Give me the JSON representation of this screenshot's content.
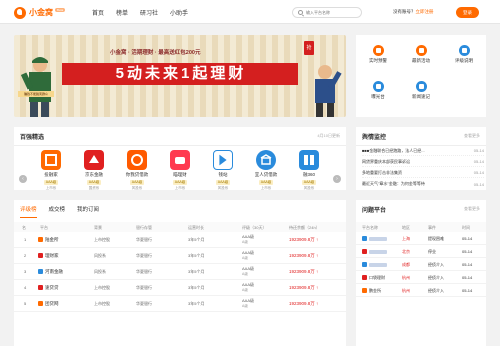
{
  "header": {
    "logo_text": "小金窝",
    "logo_beta": "Beta",
    "nav": [
      "首页",
      "榜单",
      "研习社",
      "小助手"
    ],
    "search_placeholder": "输入平台名称",
    "account_prompt": "没有账号？",
    "login": "立即注册",
    "cta": "登录"
  },
  "banner": {
    "tagline": "小金窝 · 活期理财 · 最高送红包200元",
    "headline": "5动未来1起理财",
    "left_slogan": "赚钱不能脱离群众",
    "right_badge": "抢"
  },
  "quick_links": [
    {
      "label": "实时预警",
      "color": "#ff6a00"
    },
    {
      "label": "最新活动",
      "color": "#ff6a00"
    },
    {
      "label": "评级说明",
      "color": "#2a8bdc"
    },
    {
      "label": "曝光台",
      "color": "#2a8bdc"
    },
    {
      "label": "新闻速记",
      "color": "#2a8bdc"
    }
  ],
  "top_picks": {
    "title": "百强精选",
    "date": "4月10日更新",
    "platforms": [
      {
        "name": "投融家",
        "rating": "AAA级",
        "type": "上市系",
        "color": "#ff6a00"
      },
      {
        "name": "京东金融",
        "rating": "AAA级",
        "type": "国资系",
        "color": "#e02020"
      },
      {
        "name": "你我贷借款",
        "rating": "AAA级",
        "type": "风投系",
        "color": "#ff5a00"
      },
      {
        "name": "瞄理财",
        "rating": "AAA级",
        "type": "上市系",
        "color": "#ff3a50"
      },
      {
        "name": "钱站",
        "rating": "AAA级",
        "type": "风投系",
        "color": "#2a8bdc"
      },
      {
        "name": "宜人贷借款",
        "rating": "AAA级",
        "type": "上市系",
        "color": "#2a8bdc"
      },
      {
        "name": "融360",
        "rating": "AAA级",
        "type": "风投系",
        "color": "#2a8bdc"
      }
    ]
  },
  "news": {
    "title": "舆情监控",
    "more": "查看更多",
    "items": [
      {
        "title": "■■■金融联合已经跑路，法人已经...",
        "date": "05-14"
      },
      {
        "title": "网贷界重庆本部获民事诉讼",
        "date": "05-14"
      },
      {
        "title": "多地重要打击非法集资",
        "date": "05-14"
      },
      {
        "title": "最近天气\"章水\"金融：为何金等等待",
        "date": "05-14"
      },
      {
        "title": "43家上线银行存管的(2)爆雷",
        "date": "05-14"
      }
    ]
  },
  "ranking": {
    "tabs": [
      "评级榜",
      "成交榜",
      "我的订阅"
    ],
    "columns": [
      "名",
      "平台",
      "背景",
      "银行存管",
      "运营时长",
      "评级（30天）",
      "待还余额（24h）"
    ],
    "rows": [
      {
        "rank": "1",
        "name": "陆金所",
        "bg": "上市控股",
        "bank": "华夏银行",
        "age": "3年5个月",
        "rating": "AAA级",
        "rating_sub": "A级",
        "amount": "1923909.8万",
        "color": "#ff6a00"
      },
      {
        "rank": "2",
        "name": "理财家",
        "bg": "风投系",
        "bank": "华夏银行",
        "age": "3年5个月",
        "rating": "AAA级",
        "rating_sub": "A级",
        "amount": "1923909.8万",
        "color": "#e02020"
      },
      {
        "rank": "3",
        "name": "河南金融",
        "bg": "风投系",
        "bank": "华夏银行",
        "age": "3年5个月",
        "rating": "AAA级",
        "rating_sub": "A级",
        "amount": "1923909.8万",
        "color": "#2a8bdc"
      },
      {
        "rank": "4",
        "name": "速贷贷",
        "bg": "上市控股",
        "bank": "华夏银行",
        "age": "3年5个月",
        "rating": "AAA级",
        "rating_sub": "A级",
        "amount": "1923909.8万",
        "color": "#e02020"
      },
      {
        "rank": "5",
        "name": "团贷网",
        "bg": "上市控股",
        "bank": "华夏银行",
        "age": "3年5个月",
        "rating": "AAA级",
        "rating_sub": "A级",
        "amount": "1923909.8万",
        "color": "#ff6a00"
      }
    ]
  },
  "problems": {
    "title": "问题平台",
    "more": "查看更多",
    "columns": [
      "平台名称",
      "地区",
      "事件",
      "时间"
    ],
    "rows": [
      {
        "name": "",
        "city": "上海",
        "event": "提现困难",
        "date": "05-14",
        "color": "#2a8bdc"
      },
      {
        "name": "",
        "city": "北京",
        "event": "停业",
        "date": "05-14",
        "color": "#e02020"
      },
      {
        "name": "",
        "city": "成都",
        "event": "经侦介入",
        "date": "05-14",
        "color": "#2a8bdc"
      },
      {
        "name": "口袋理财",
        "city": "杭州",
        "event": "经侦介入",
        "date": "05-14",
        "color": "#e02020"
      },
      {
        "name": "鹏金所",
        "city": "杭州",
        "event": "经侦介入",
        "date": "05-14",
        "color": "#ff6a00"
      }
    ]
  }
}
